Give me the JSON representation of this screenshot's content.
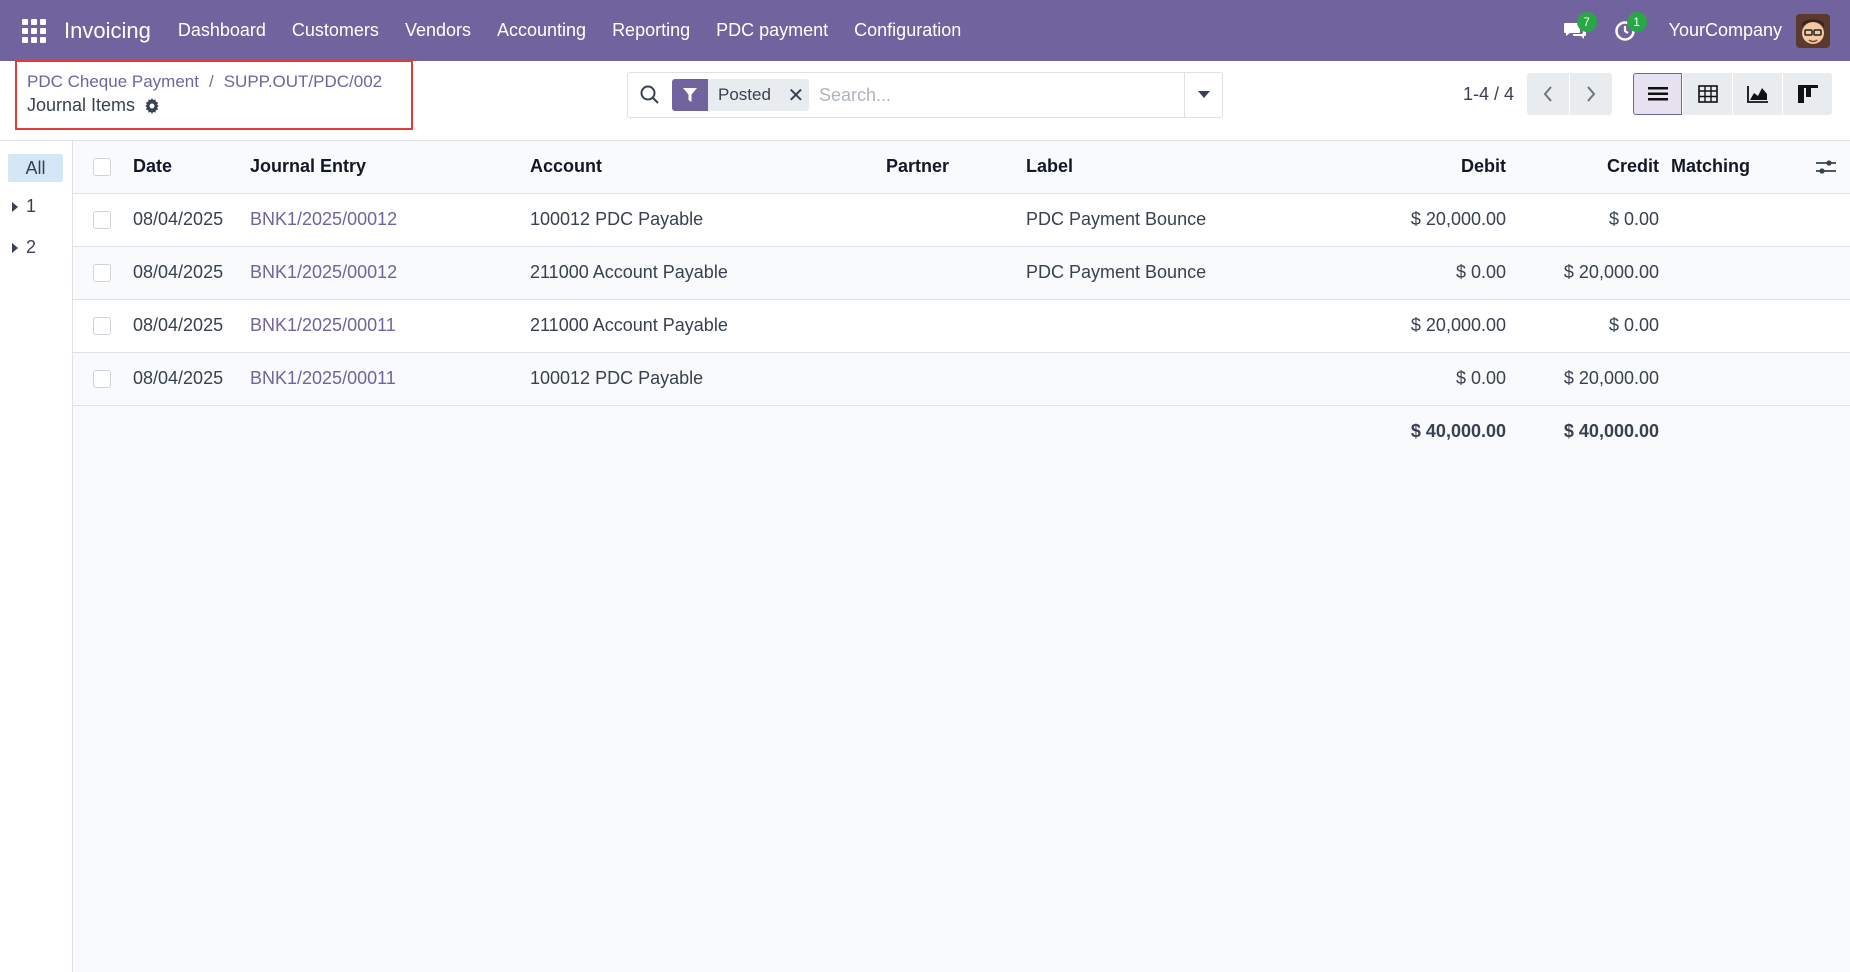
{
  "navbar": {
    "app_name": "Invoicing",
    "menu": [
      "Dashboard",
      "Customers",
      "Vendors",
      "Accounting",
      "Reporting",
      "PDC payment",
      "Configuration"
    ],
    "messages_count": "7",
    "activities_count": "1",
    "company": "YourCompany",
    "bg_color": "#71639e"
  },
  "breadcrumb": {
    "parent": "PDC Cheque Payment",
    "record": "SUPP.OUT/PDC/002",
    "title": "Journal Items"
  },
  "search": {
    "facet": "Posted",
    "placeholder": "Search..."
  },
  "pager": {
    "range": "1-4 / 4"
  },
  "sidepanel": {
    "all_label": "All",
    "groups": [
      "1",
      "2"
    ]
  },
  "table": {
    "columns": [
      "Date",
      "Journal Entry",
      "Account",
      "Partner",
      "Label",
      "Debit",
      "Credit",
      "Matching"
    ],
    "rows": [
      {
        "date": "08/04/2025",
        "entry": "BNK1/2025/00012",
        "account": "100012 PDC Payable",
        "partner": "",
        "label": "PDC Payment Bounce",
        "debit": "$ 20,000.00",
        "credit": "$ 0.00",
        "matching": ""
      },
      {
        "date": "08/04/2025",
        "entry": "BNK1/2025/00012",
        "account": "211000 Account Payable",
        "partner": "",
        "label": "PDC Payment Bounce",
        "debit": "$ 0.00",
        "credit": "$ 20,000.00",
        "matching": ""
      },
      {
        "date": "08/04/2025",
        "entry": "BNK1/2025/00011",
        "account": "211000 Account Payable",
        "partner": "",
        "label": "",
        "debit": "$ 20,000.00",
        "credit": "$ 0.00",
        "matching": ""
      },
      {
        "date": "08/04/2025",
        "entry": "BNK1/2025/00011",
        "account": "100012 PDC Payable",
        "partner": "",
        "label": "",
        "debit": "$ 0.00",
        "credit": "$ 20,000.00",
        "matching": ""
      }
    ],
    "totals": {
      "debit": "$ 40,000.00",
      "credit": "$ 40,000.00"
    }
  }
}
